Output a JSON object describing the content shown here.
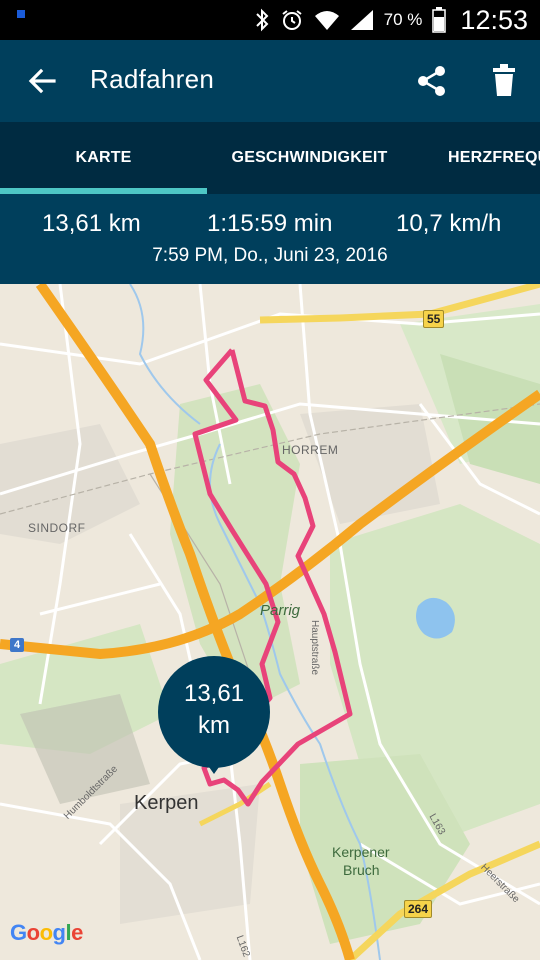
{
  "status_bar": {
    "battery_percent": "70 %",
    "time": "12:53",
    "icons": [
      "bluetooth-icon",
      "alarm-icon",
      "wifi-icon",
      "signal-icon",
      "battery-icon"
    ]
  },
  "app_bar": {
    "title": "Radfahren",
    "back_icon": "arrow-back-icon",
    "share_icon": "share-icon",
    "delete_icon": "trash-icon"
  },
  "tabs": [
    {
      "label": "KARTE",
      "active": true
    },
    {
      "label": "GESCHWINDIGKEIT",
      "active": false
    },
    {
      "label": "HERZFREQU",
      "active": false
    }
  ],
  "summary": {
    "distance": "13,61 km",
    "duration": "1:15:59 min",
    "speed": "10,7 km/h",
    "datetime": "7:59 PM, Do., Juni 23, 2016"
  },
  "map": {
    "bubble_value": "13,61",
    "bubble_unit": "km",
    "labels": {
      "horrem": "HORREM",
      "sindorf": "SINDORF",
      "parrig": "Parrig",
      "kerpen": "Kerpen",
      "kerpener": "Kerpener",
      "bruch": "Bruch",
      "hauptstrasse": "Hauptstraße",
      "humboldtstrasse": "Humboldtstraße",
      "heerstrasse": "Heerstraße",
      "l163": "L163",
      "l162": "L162"
    },
    "shields": {
      "b55": "55",
      "b264": "264",
      "a4": "4"
    },
    "attribution": "Google",
    "colors": {
      "route": "#e8437a",
      "highway": "#f5a623",
      "header": "#003f5c",
      "tab_indicator": "#4ec7c5"
    }
  }
}
